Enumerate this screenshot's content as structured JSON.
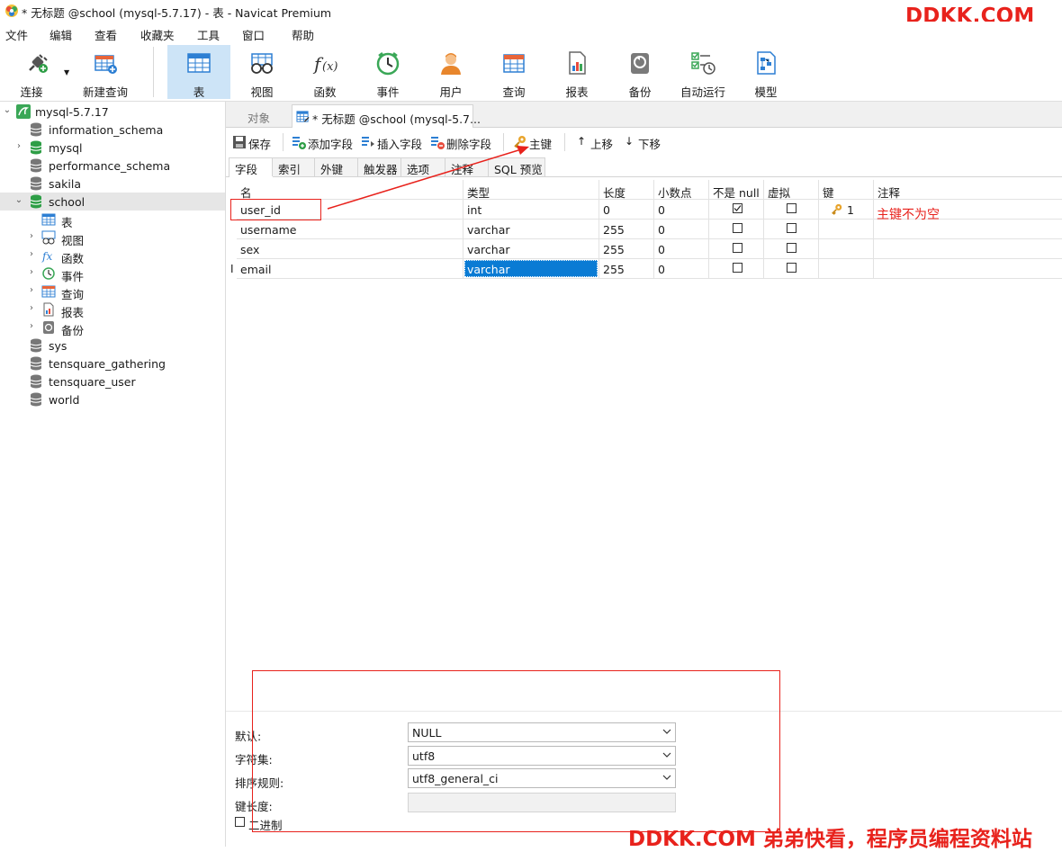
{
  "window": {
    "title": "* 无标题 @school (mysql-5.7.17) - 表 - Navicat Premium"
  },
  "watermark": {
    "top": "DDKK.COM",
    "bottom": "DDKK.COM 弟弟快看，程序员编程资料站"
  },
  "menu": [
    "文件",
    "编辑",
    "查看",
    "收藏夹",
    "工具",
    "窗口",
    "帮助"
  ],
  "toolbar": {
    "connect": "连接",
    "new_query": "新建查询",
    "table": "表",
    "view": "视图",
    "function": "函数",
    "event": "事件",
    "user": "用户",
    "query": "查询",
    "report": "报表",
    "backup": "备份",
    "automation": "自动运行",
    "model": "模型"
  },
  "tree": {
    "connection": "mysql-5.7.17",
    "items": [
      "information_schema",
      "mysql",
      "performance_schema",
      "sakila",
      "school",
      "表",
      "视图",
      "函数",
      "事件",
      "查询",
      "报表",
      "备份",
      "sys",
      "tensquare_gathering",
      "tensquare_user",
      "world"
    ]
  },
  "tabs": {
    "objects": "对象",
    "doc": "* 无标题 @school (mysql-5.7..."
  },
  "actions": {
    "save": "保存",
    "add_field": "添加字段",
    "insert_field": "插入字段",
    "delete_field": "删除字段",
    "primary_key": "主键",
    "move_up": "上移",
    "move_down": "下移"
  },
  "field_tabs": [
    "字段",
    "索引",
    "外键",
    "触发器",
    "选项",
    "注释",
    "SQL 预览"
  ],
  "grid": {
    "columns": [
      "名",
      "类型",
      "长度",
      "小数点",
      "不是 null",
      "虚拟",
      "键",
      "注释"
    ],
    "rows": [
      {
        "name": "user_id",
        "type": "int",
        "length": "0",
        "decimals": "0",
        "not_null": true,
        "virtual": false,
        "key": "1"
      },
      {
        "name": "username",
        "type": "varchar",
        "length": "255",
        "decimals": "0",
        "not_null": false,
        "virtual": false,
        "key": ""
      },
      {
        "name": "sex",
        "type": "varchar",
        "length": "255",
        "decimals": "0",
        "not_null": false,
        "virtual": false,
        "key": ""
      },
      {
        "name": "email",
        "type": "varchar",
        "length": "255",
        "decimals": "0",
        "not_null": false,
        "virtual": false,
        "key": ""
      }
    ],
    "cursor_marker": "I"
  },
  "annotation": {
    "pk_note": "主键不为空"
  },
  "props": {
    "default_label": "默认:",
    "default_value": "NULL",
    "charset_label": "字符集:",
    "charset_value": "utf8",
    "collation_label": "排序规则:",
    "collation_value": "utf8_general_ci",
    "keylen_label": "键长度:",
    "binary_label": "二进制"
  },
  "colors": {
    "accent_red": "#e8221c",
    "selection_blue": "#0a7bd4",
    "active_tool": "#cde4f7"
  }
}
